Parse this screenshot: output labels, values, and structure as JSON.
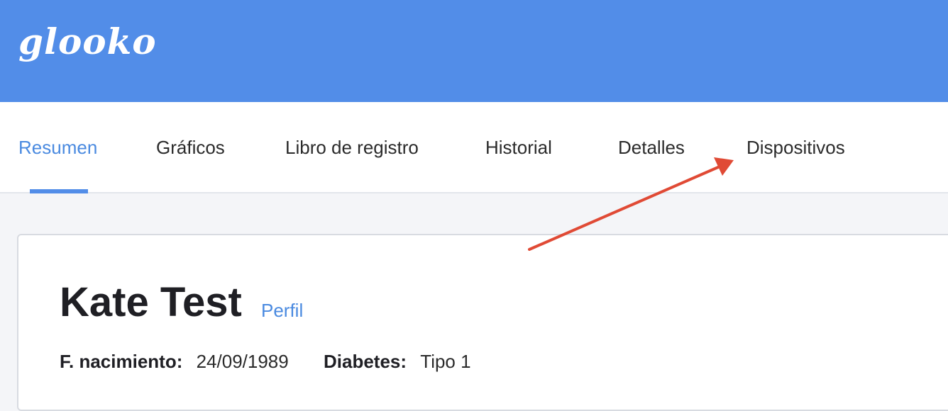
{
  "header": {
    "logo_text": "glooko",
    "background_color": "#528de8"
  },
  "nav": {
    "tabs": [
      {
        "label": "Resumen",
        "active": true
      },
      {
        "label": "Gráficos",
        "active": false
      },
      {
        "label": "Libro de registro",
        "active": false
      },
      {
        "label": "Historial",
        "active": false
      },
      {
        "label": "Detalles",
        "active": false
      },
      {
        "label": "Dispositivos",
        "active": false
      }
    ],
    "active_color": "#4a8ae0"
  },
  "patient": {
    "name": "Kate Test",
    "profile_link": "Perfil",
    "dob_label": "F. nacimiento:",
    "dob_value": "24/09/1989",
    "diabetes_label": "Diabetes:",
    "diabetes_value": "Tipo 1"
  },
  "annotation": {
    "arrow_color": "#e04a35",
    "points_to": "Dispositivos"
  }
}
